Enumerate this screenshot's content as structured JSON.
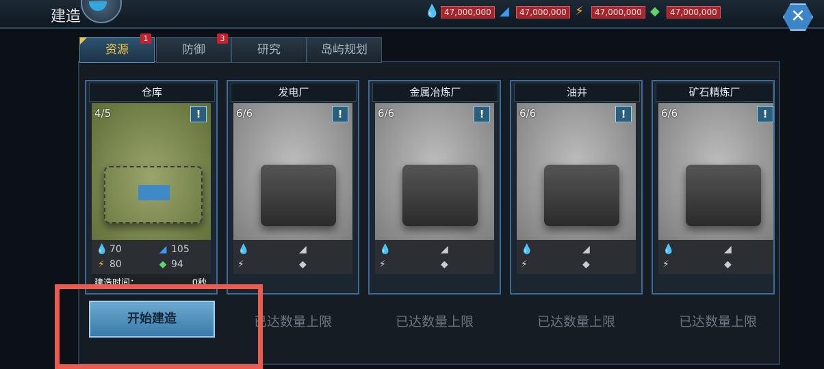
{
  "window": {
    "title": "建造",
    "close_label": "✕"
  },
  "resources": [
    {
      "icon": "oil-drop-icon",
      "glyph": "💧",
      "color": "#a57ad8",
      "value": "47,000,000"
    },
    {
      "icon": "metal-plate-icon",
      "glyph": "◢",
      "color": "#3a9bf0",
      "value": "47,000,000"
    },
    {
      "icon": "energy-bolt-icon",
      "glyph": "⚡",
      "color": "#f0b23a",
      "value": "47,000,000"
    },
    {
      "icon": "ore-crystal-icon",
      "glyph": "◆",
      "color": "#5fd46a",
      "value": "47,000,000"
    }
  ],
  "tabs": [
    {
      "label": "资源",
      "badge": "1",
      "active": true
    },
    {
      "label": "防御",
      "badge": "3",
      "active": false
    },
    {
      "label": "研究",
      "badge": "",
      "active": false
    },
    {
      "label": "岛屿规划",
      "badge": "",
      "active": false
    }
  ],
  "cards": [
    {
      "name": "仓库",
      "count": "4/5",
      "info": "!",
      "costs": {
        "oil": "70",
        "metal": "105",
        "energy": "80",
        "ore": "94"
      },
      "time_label": "建造时间：",
      "time_value": "0秒",
      "action": "开始建造"
    },
    {
      "name": "发电厂",
      "count": "6/6",
      "info": "!",
      "costs": {
        "oil": "",
        "metal": "",
        "energy": "",
        "ore": ""
      },
      "action": "已达数量上限"
    },
    {
      "name": "金属冶炼厂",
      "count": "6/6",
      "info": "!",
      "costs": {
        "oil": "",
        "metal": "",
        "energy": "",
        "ore": ""
      },
      "action": "已达数量上限"
    },
    {
      "name": "油井",
      "count": "6/6",
      "info": "!",
      "costs": {
        "oil": "",
        "metal": "",
        "energy": "",
        "ore": ""
      },
      "action": "已达数量上限"
    },
    {
      "name": "矿石精炼厂",
      "count": "6/6",
      "info": "!",
      "costs": {
        "oil": "",
        "metal": "",
        "energy": "",
        "ore": ""
      },
      "action": "已达数量上限"
    }
  ],
  "colors": {
    "accent": "#3c6b97",
    "tab_active_text": "#f2c642",
    "badge": "#c7202a",
    "highlight": "#ea5c4f"
  }
}
